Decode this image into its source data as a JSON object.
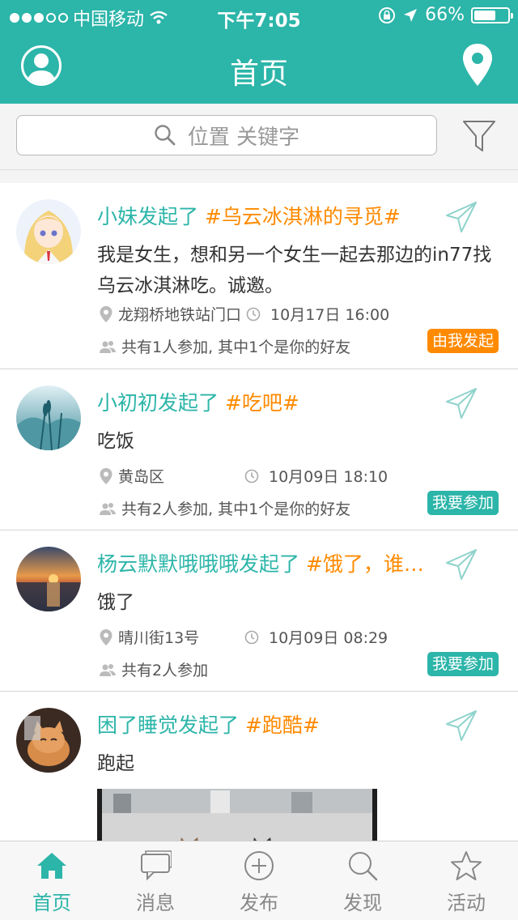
{
  "status_bar": {
    "carrier": "中国移动",
    "time": "下午7:05",
    "battery": "66%",
    "battery_level": 0.66
  },
  "nav": {
    "title": "首页",
    "left_icon": "user-avatar-icon",
    "right_icon": "location-pin-icon"
  },
  "search": {
    "placeholder": "位置 关键字",
    "icon": "search-icon",
    "filter_icon": "filter-icon"
  },
  "feed": [
    {
      "user": "小妹发起了",
      "tag": "#乌云冰淇淋的寻觅#",
      "body": "我是女生，想和另一个女生一起去那边的in77找乌云冰淇淋吃。诚邀。",
      "location": "龙翔桥地铁站门口",
      "time": "10月17日 16:00",
      "participants": "共有1人参加, 其中1个是你的好友",
      "badge": "由我发起",
      "badge_color": "#ff8a00"
    },
    {
      "user": "小初初发起了",
      "tag": "#吃吧#",
      "body": "吃饭",
      "location": "黄岛区",
      "time": "10月09日 18:10",
      "participants": "共有2人参加, 其中1个是你的好友",
      "badge": "我要参加",
      "badge_color": "#2cb5a9"
    },
    {
      "user": "杨云默默哦哦哦发起了",
      "tag": "#饿了，谁…",
      "body": "饿了",
      "location": "晴川街13号",
      "time": "10月09日 08:29",
      "participants": "共有2人参加",
      "badge": "我要参加",
      "badge_color": "#2cb5a9"
    },
    {
      "user": "困了睡觉发起了",
      "tag": "#跑酷#",
      "body": "跑起"
    }
  ],
  "tabbar": [
    {
      "label": "首页",
      "icon": "home-icon",
      "active": true
    },
    {
      "label": "消息",
      "icon": "message-icon",
      "active": false
    },
    {
      "label": "发布",
      "icon": "add-circle-icon",
      "active": false
    },
    {
      "label": "发现",
      "icon": "search-icon",
      "active": false
    },
    {
      "label": "活动",
      "icon": "star-icon",
      "active": false
    }
  ],
  "colors": {
    "primary": "#2cb5a9",
    "accent": "#ff8a00"
  }
}
